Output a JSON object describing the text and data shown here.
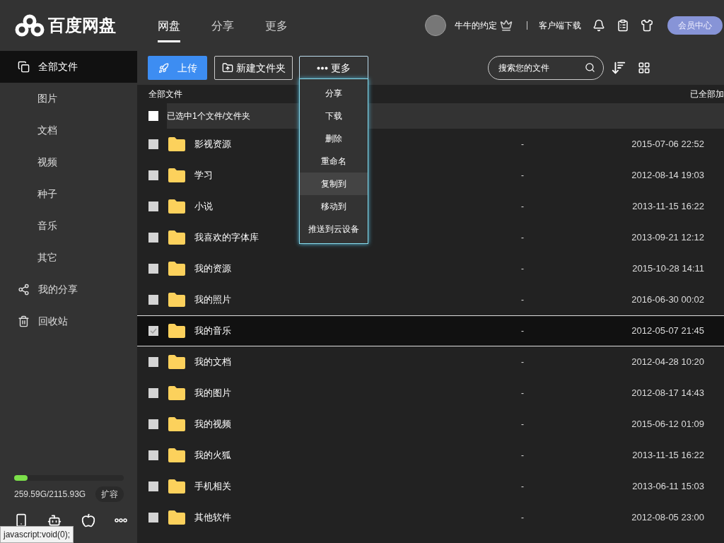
{
  "logo": {
    "text": "百度网盘"
  },
  "nav": [
    {
      "label": "网盘",
      "selected": true
    },
    {
      "label": "分享",
      "selected": false
    },
    {
      "label": "更多",
      "selected": false
    }
  ],
  "user": {
    "name": "牛牛的约定",
    "client_link": "客户端下载",
    "vip_button": "会员中心"
  },
  "sidebar": {
    "items": [
      {
        "label": "全部文件",
        "kind": "main",
        "selected": true
      },
      {
        "label": "图片",
        "kind": "sub",
        "selected": false
      },
      {
        "label": "文档",
        "kind": "sub",
        "selected": false
      },
      {
        "label": "视频",
        "kind": "sub",
        "selected": false
      },
      {
        "label": "种子",
        "kind": "sub",
        "selected": false
      },
      {
        "label": "音乐",
        "kind": "sub",
        "selected": false
      },
      {
        "label": "其它",
        "kind": "sub",
        "selected": false
      },
      {
        "label": "我的分享",
        "kind": "share",
        "selected": false
      },
      {
        "label": "回收站",
        "kind": "trash",
        "selected": false
      }
    ],
    "storage": {
      "level": 0.12,
      "reading": "259.59G/2115.93G",
      "expand_button": "扩容"
    }
  },
  "toolbar": {
    "upload": "上传",
    "new_folder": "新建文件夹",
    "more": "更多",
    "search_placeholder": "搜索您的文件"
  },
  "more_menu": [
    {
      "label": "分享",
      "selected": false
    },
    {
      "label": "下载",
      "selected": false
    },
    {
      "label": "删除",
      "selected": false
    },
    {
      "label": "重命名",
      "selected": false
    },
    {
      "label": "复制到",
      "selected": true
    },
    {
      "label": "移动到",
      "selected": false
    },
    {
      "label": "推送到云设备",
      "selected": false
    }
  ],
  "breadcrumb": "全部文件",
  "loaded_note": "已全部加",
  "selection_bar": {
    "label": "已选中1个文件/文件夹",
    "checked": false
  },
  "files": [
    {
      "name": "影视资源",
      "size": "-",
      "date": "2015-07-06 22:52",
      "checked": false,
      "selected": false
    },
    {
      "name": "学习",
      "size": "-",
      "date": "2012-08-14 19:03",
      "checked": false,
      "selected": false
    },
    {
      "name": "小说",
      "size": "-",
      "date": "2013-11-15 16:22",
      "checked": false,
      "selected": false
    },
    {
      "name": "我喜欢的字体库",
      "size": "-",
      "date": "2013-09-21 12:12",
      "checked": false,
      "selected": false
    },
    {
      "name": "我的资源",
      "size": "-",
      "date": "2015-10-28 14:11",
      "checked": false,
      "selected": false
    },
    {
      "name": "我的照片",
      "size": "-",
      "date": "2016-06-30 00:02",
      "checked": false,
      "selected": false
    },
    {
      "name": "我的音乐",
      "size": "-",
      "date": "2012-05-07 21:45",
      "checked": true,
      "selected": true
    },
    {
      "name": "我的文档",
      "size": "-",
      "date": "2012-04-28 10:20",
      "checked": false,
      "selected": false
    },
    {
      "name": "我的图片",
      "size": "-",
      "date": "2012-08-17 14:43",
      "checked": false,
      "selected": false
    },
    {
      "name": "我的视频",
      "size": "-",
      "date": "2015-06-12 01:09",
      "checked": false,
      "selected": false
    },
    {
      "name": "我的火狐",
      "size": "-",
      "date": "2013-11-15 16:22",
      "checked": false,
      "selected": false
    },
    {
      "name": "手机相关",
      "size": "-",
      "date": "2013-06-11 15:03",
      "checked": false,
      "selected": false
    },
    {
      "name": "其他软件",
      "size": "-",
      "date": "2012-08-05 23:00",
      "checked": false,
      "selected": false
    }
  ],
  "status_tooltip": "javascript:void(0);"
}
